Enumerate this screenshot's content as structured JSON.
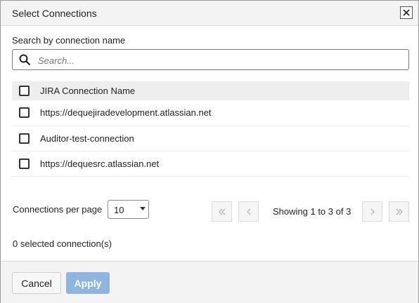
{
  "dialog": {
    "title": "Select Connections"
  },
  "search": {
    "label": "Search by connection name",
    "placeholder": "Search...",
    "value": ""
  },
  "table": {
    "header": "JIRA Connection Name",
    "rows": [
      "https://dequejiradevelopment.atlassian.net",
      "Auditor-test-connection",
      "https://dequesrc.atlassian.net"
    ]
  },
  "pagination": {
    "per_page_label": "Connections per page",
    "per_page_value": "10",
    "showing_text": "Showing 1 to 3 of 3"
  },
  "selection": {
    "count_text": "0 selected connection(s)"
  },
  "footer": {
    "cancel_label": "Cancel",
    "apply_label": "Apply"
  },
  "colors": {
    "apply_button_disabled": "#90b4e0",
    "header_bg": "#f3f3f3"
  }
}
